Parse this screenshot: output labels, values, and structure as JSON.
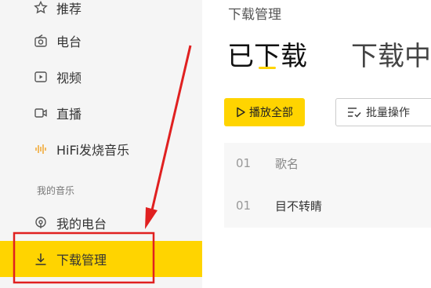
{
  "sidebar": {
    "items": [
      {
        "label": "推荐",
        "icon": "star-icon"
      },
      {
        "label": "电台",
        "icon": "radio-icon"
      },
      {
        "label": "视频",
        "icon": "video-icon"
      },
      {
        "label": "直播",
        "icon": "live-icon"
      },
      {
        "label": "HiFi发烧音乐",
        "icon": "hifi-icon"
      }
    ],
    "section_title": "我的音乐",
    "my_items": [
      {
        "label": "我的电台",
        "icon": "podcast-icon"
      },
      {
        "label": "下载管理",
        "icon": "download-icon"
      }
    ]
  },
  "main": {
    "breadcrumb": "下载管理",
    "tabs": [
      {
        "label": "已下载"
      },
      {
        "label": "下载中"
      }
    ],
    "buttons": {
      "play_all": "播放全部",
      "batch": "批量操作"
    },
    "table": {
      "header": {
        "num": "01",
        "title": "歌名"
      },
      "rows": [
        {
          "num": "01",
          "title": "目不转睛"
        }
      ]
    }
  },
  "colors": {
    "accent": "#ffd400",
    "annotation": "#e02020"
  }
}
